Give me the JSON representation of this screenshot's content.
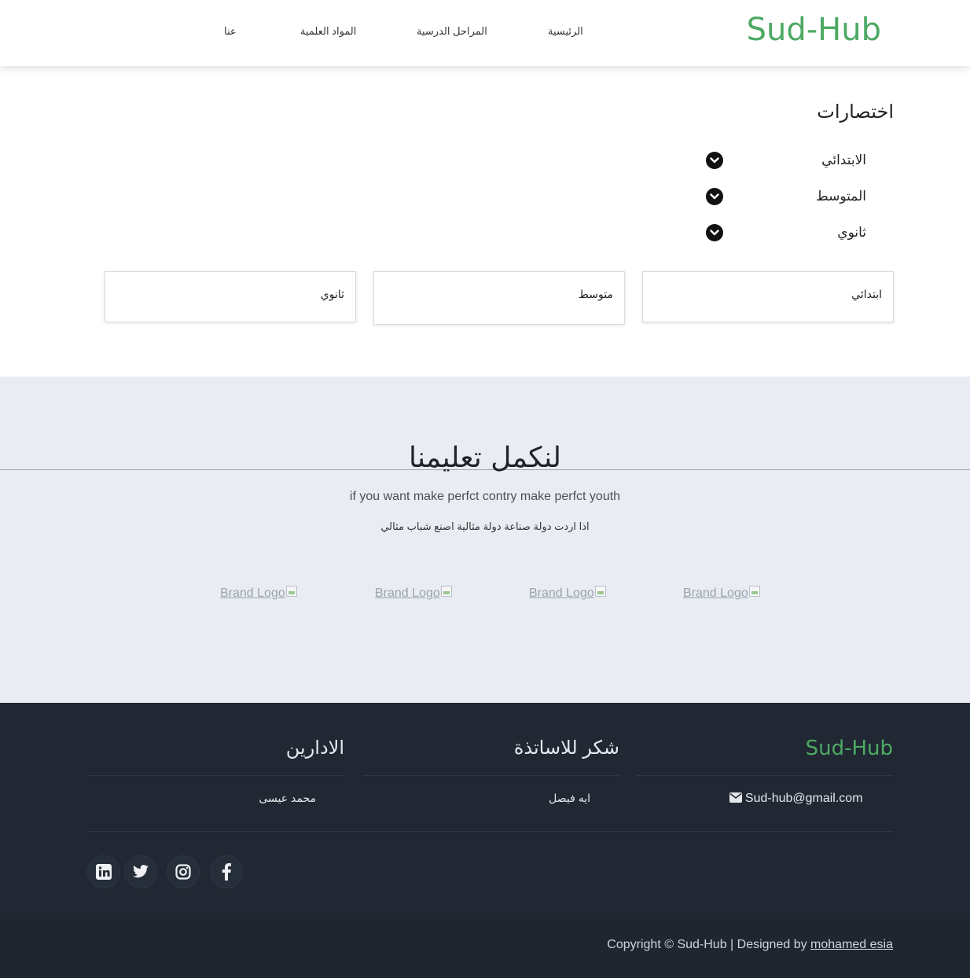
{
  "header": {
    "brand": "Sud-Hub",
    "nav": [
      "الرئيسية",
      "المراحل الدرسية",
      "المواد العلمية",
      "عنا"
    ]
  },
  "shortcuts": {
    "title": "اختصارات",
    "items": [
      "الابتدائي",
      "المتوسط",
      "ثانوي"
    ]
  },
  "cards": [
    "ابتدائي",
    "متوسط",
    "ثانوي"
  ],
  "hero": {
    "title": "لنكمل تعليمنا",
    "subtitle_en": "if you want make perfct contry make perfct youth",
    "subtitle_ar": "اذا اردت دولة صناعة دولة مثالية اصنع شباب مثالي",
    "logo_alt": "Brand Logo"
  },
  "footer": {
    "brand": "Sud-Hub",
    "email": "Sud-hub@gmail.com",
    "col2_title": "شكر للاساتذة",
    "col2_item": "ايه فيصل",
    "col3_title": "الادارين",
    "col3_item": "محمد عيسى",
    "social": [
      "linkedin-icon",
      "twitter-icon",
      "instagram-icon",
      "facebook-icon"
    ],
    "copyright_prefix": "Copyright © Sud-Hub | Designed by",
    "designer": "mohamed esia"
  },
  "colors": {
    "brand_green": "#4daa64",
    "footer_bg": "#212833",
    "hero_bg": "#e9edf3"
  }
}
